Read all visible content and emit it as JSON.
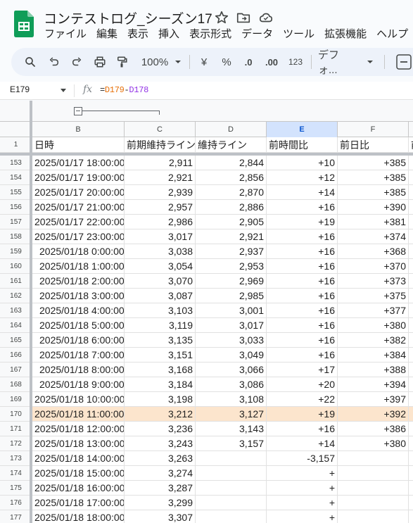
{
  "document": {
    "title": "コンテストログ_シーズン17",
    "menu": [
      "ファイル",
      "編集",
      "表示",
      "挿入",
      "表示形式",
      "データ",
      "ツール",
      "拡張機能",
      "ヘルプ"
    ]
  },
  "toolbar": {
    "zoom": "100%",
    "currency": "¥",
    "percent": "%",
    "decrease_decimal": ".0",
    "increase_decimal": ".00",
    "number_format": "123",
    "font": "デフォ..."
  },
  "formula_bar": {
    "cell_ref": "E179",
    "fx": "fx",
    "formula_eq": "=",
    "formula_ref1": "D179",
    "formula_op": "-",
    "formula_ref2": "D178"
  },
  "sheet": {
    "columns": [
      "B",
      "C",
      "D",
      "E",
      "F"
    ],
    "selected_column": "E",
    "header_row_num": "1",
    "headers": [
      "日時",
      "前期維持ライン",
      "維持ライン",
      "前時間比",
      "前日比",
      "前"
    ],
    "highlight_row": "170",
    "highlight_color": "#fce5cd",
    "rows": [
      {
        "n": "153",
        "b": "2025/01/17 18:00:00",
        "c": "2,911",
        "d": "2,844",
        "e": "+10",
        "f": "+385"
      },
      {
        "n": "154",
        "b": "2025/01/17 19:00:00",
        "c": "2,921",
        "d": "2,856",
        "e": "+12",
        "f": "+385"
      },
      {
        "n": "155",
        "b": "2025/01/17 20:00:00",
        "c": "2,939",
        "d": "2,870",
        "e": "+14",
        "f": "+385"
      },
      {
        "n": "156",
        "b": "2025/01/17 21:00:00",
        "c": "2,957",
        "d": "2,886",
        "e": "+16",
        "f": "+390"
      },
      {
        "n": "157",
        "b": "2025/01/17 22:00:00",
        "c": "2,986",
        "d": "2,905",
        "e": "+19",
        "f": "+381"
      },
      {
        "n": "158",
        "b": "2025/01/17 23:00:00",
        "c": "3,017",
        "d": "2,921",
        "e": "+16",
        "f": "+374"
      },
      {
        "n": "159",
        "b": "2025/01/18 0:00:00",
        "c": "3,038",
        "d": "2,937",
        "e": "+16",
        "f": "+368"
      },
      {
        "n": "160",
        "b": "2025/01/18 1:00:00",
        "c": "3,054",
        "d": "2,953",
        "e": "+16",
        "f": "+370"
      },
      {
        "n": "161",
        "b": "2025/01/18 2:00:00",
        "c": "3,070",
        "d": "2,969",
        "e": "+16",
        "f": "+373"
      },
      {
        "n": "162",
        "b": "2025/01/18 3:00:00",
        "c": "3,087",
        "d": "2,985",
        "e": "+16",
        "f": "+375"
      },
      {
        "n": "163",
        "b": "2025/01/18 4:00:00",
        "c": "3,103",
        "d": "3,001",
        "e": "+16",
        "f": "+377"
      },
      {
        "n": "164",
        "b": "2025/01/18 5:00:00",
        "c": "3,119",
        "d": "3,017",
        "e": "+16",
        "f": "+380"
      },
      {
        "n": "165",
        "b": "2025/01/18 6:00:00",
        "c": "3,135",
        "d": "3,033",
        "e": "+16",
        "f": "+382"
      },
      {
        "n": "166",
        "b": "2025/01/18 7:00:00",
        "c": "3,151",
        "d": "3,049",
        "e": "+16",
        "f": "+384"
      },
      {
        "n": "167",
        "b": "2025/01/18 8:00:00",
        "c": "3,168",
        "d": "3,066",
        "e": "+17",
        "f": "+388"
      },
      {
        "n": "168",
        "b": "2025/01/18 9:00:00",
        "c": "3,184",
        "d": "3,086",
        "e": "+20",
        "f": "+394"
      },
      {
        "n": "169",
        "b": "2025/01/18 10:00:00",
        "c": "3,198",
        "d": "3,108",
        "e": "+22",
        "f": "+397"
      },
      {
        "n": "170",
        "b": "2025/01/18 11:00:00",
        "c": "3,212",
        "d": "3,127",
        "e": "+19",
        "f": "+392"
      },
      {
        "n": "171",
        "b": "2025/01/18 12:00:00",
        "c": "3,236",
        "d": "3,143",
        "e": "+16",
        "f": "+386"
      },
      {
        "n": "172",
        "b": "2025/01/18 13:00:00",
        "c": "3,243",
        "d": "3,157",
        "e": "+14",
        "f": "+380"
      },
      {
        "n": "173",
        "b": "2025/01/18 14:00:00",
        "c": "3,263",
        "d": "",
        "e": "-3,157",
        "f": ""
      },
      {
        "n": "174",
        "b": "2025/01/18 15:00:00",
        "c": "3,274",
        "d": "",
        "e": "+",
        "f": ""
      },
      {
        "n": "175",
        "b": "2025/01/18 16:00:00",
        "c": "3,287",
        "d": "",
        "e": "+",
        "f": ""
      },
      {
        "n": "176",
        "b": "2025/01/18 17:00:00",
        "c": "3,299",
        "d": "",
        "e": "+",
        "f": ""
      },
      {
        "n": "177",
        "b": "2025/01/18 18:00:00",
        "c": "3,307",
        "d": "",
        "e": "+",
        "f": ""
      }
    ]
  }
}
